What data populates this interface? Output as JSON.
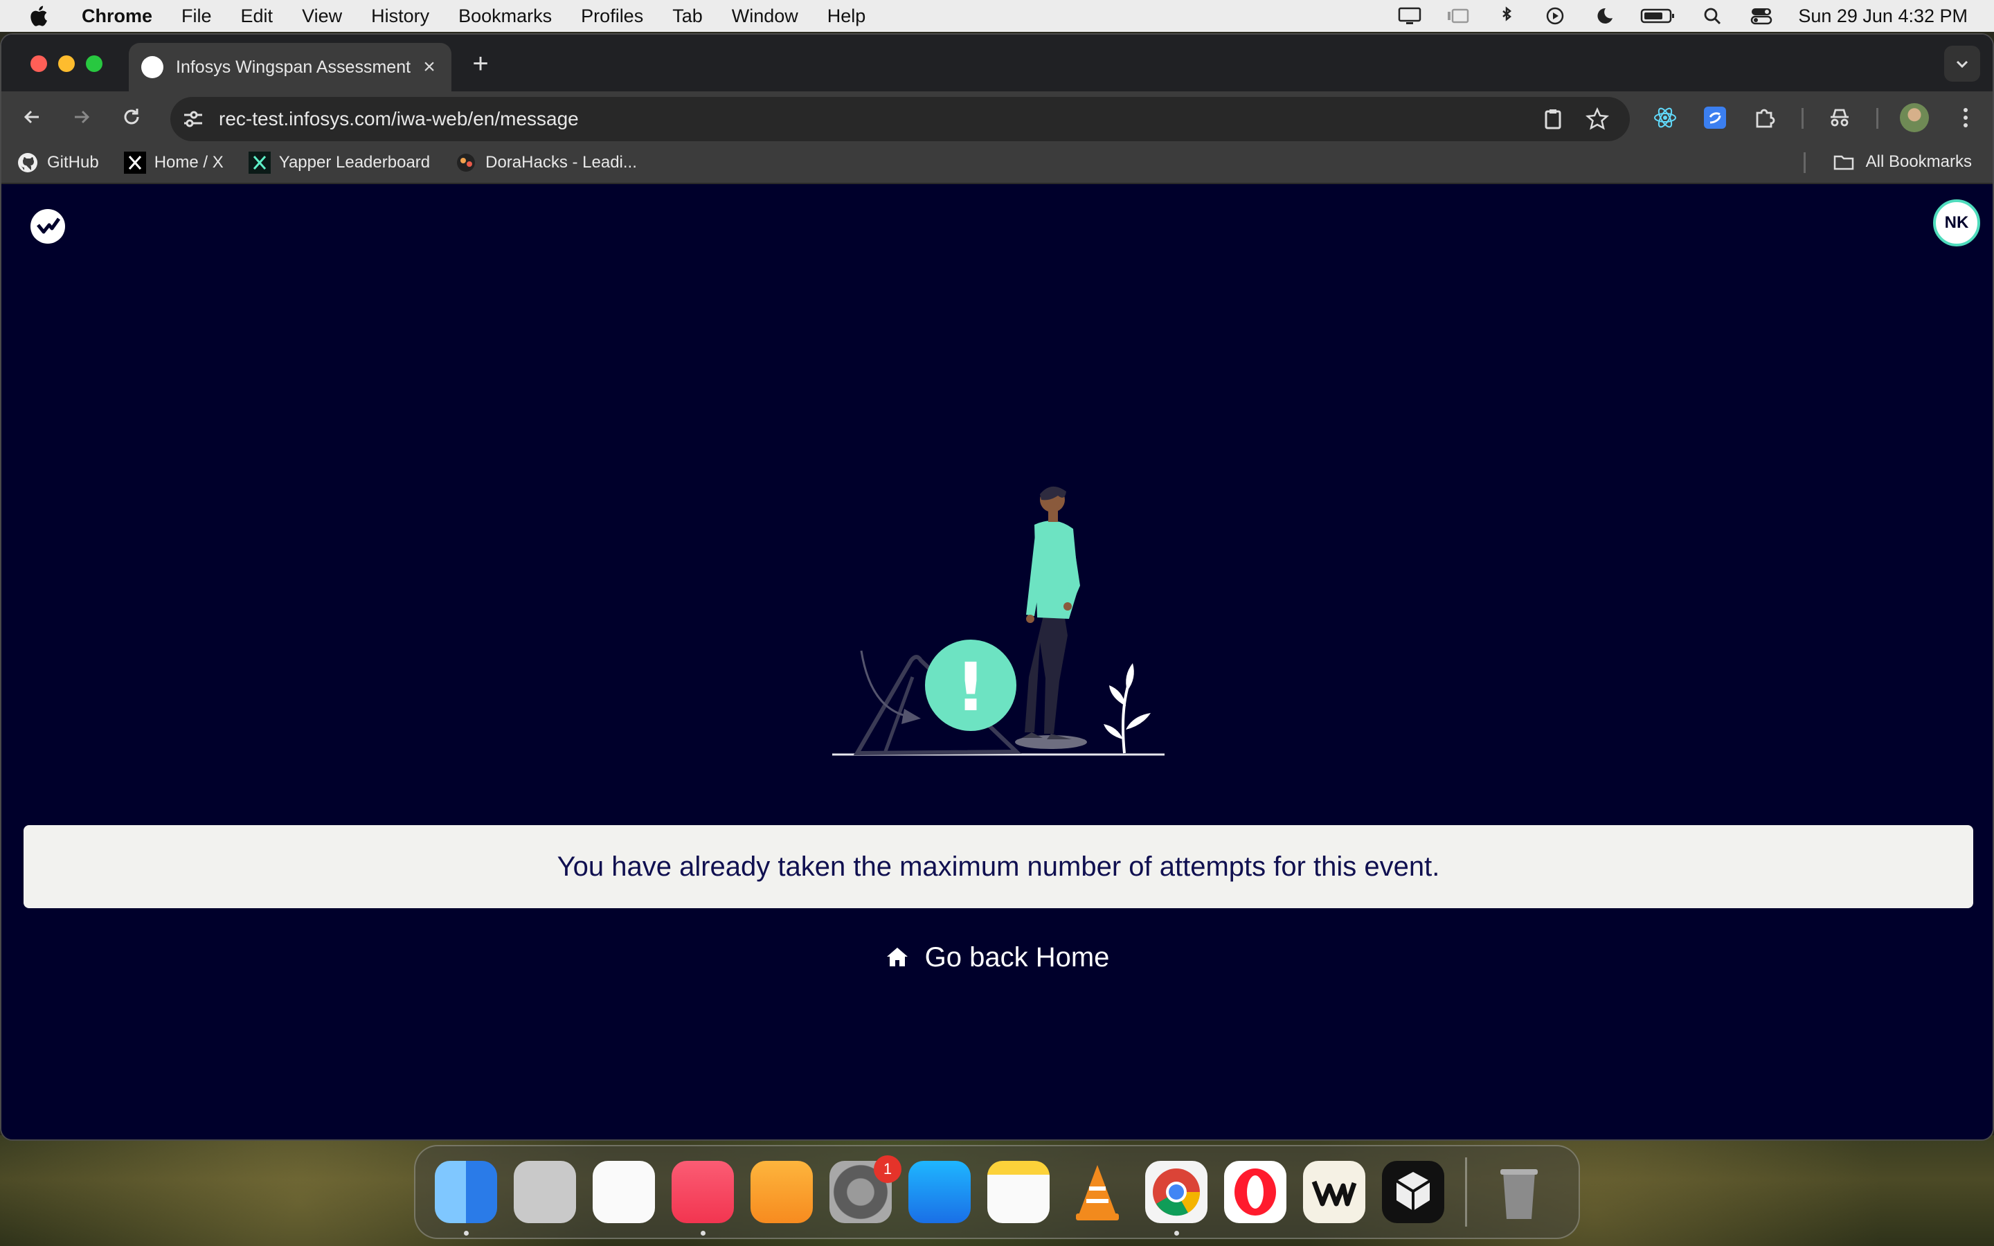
{
  "menubar": {
    "app_name": "Chrome",
    "items": [
      "File",
      "Edit",
      "View",
      "History",
      "Bookmarks",
      "Profiles",
      "Tab",
      "Window",
      "Help"
    ],
    "datetime": "Sun 29 Jun  4:32 PM"
  },
  "browser": {
    "tab_title": "Infosys Wingspan Assessment",
    "new_tab_label": "+",
    "url": "rec-test.infosys.com/iwa-web/en/message",
    "bookmarks": [
      "GitHub",
      "Home / X",
      "Yapper Leaderboard",
      "DoraHacks - Leadi..."
    ],
    "all_bookmarks_label": "All Bookmarks"
  },
  "page": {
    "user_initials": "NK",
    "message": "You have already taken the maximum number of attempts for this event.",
    "home_link": "Go back Home",
    "illustration_mark": "!"
  },
  "dock": {
    "settings_badge": "1"
  },
  "colors": {
    "page_background": "#00002b",
    "accent": "#4fdcbd",
    "message_text": "#101050"
  }
}
